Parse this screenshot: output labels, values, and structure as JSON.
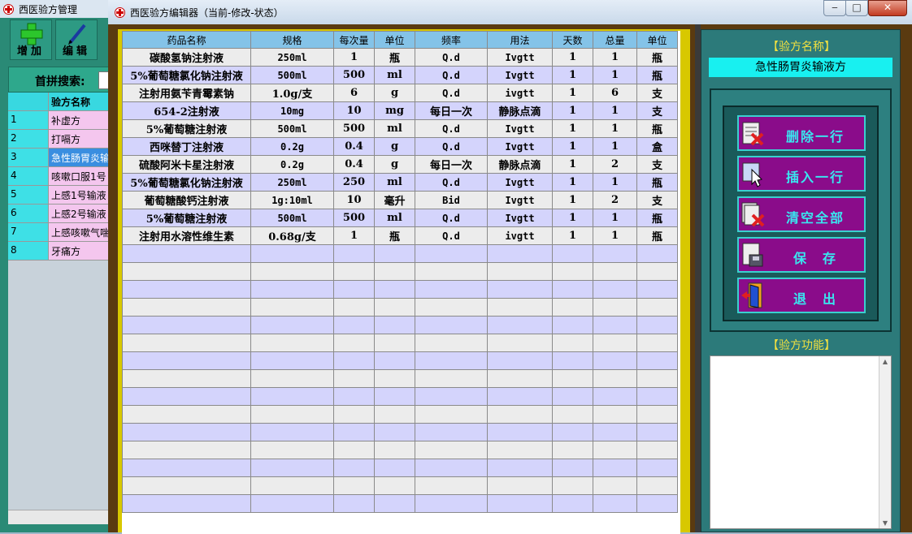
{
  "background_window": {
    "title": "西医验方管理",
    "toolbar": {
      "add_label": "增加",
      "edit_label": "编辑"
    },
    "search_label": "首拼搜索:",
    "grid": {
      "header": {
        "num": "",
        "name": "验方名称"
      },
      "rows": [
        {
          "num": "1",
          "name": "补虚方"
        },
        {
          "num": "2",
          "name": "打嗝方"
        },
        {
          "num": "3",
          "name": "急性肠胃炎输"
        },
        {
          "num": "4",
          "name": "咳嗽口服1号"
        },
        {
          "num": "5",
          "name": "上感1号输液"
        },
        {
          "num": "6",
          "name": "上感2号输液"
        },
        {
          "num": "7",
          "name": "上感咳嗽气喘"
        },
        {
          "num": "8",
          "name": "牙痛方"
        }
      ]
    }
  },
  "main_window": {
    "title": "西医验方编辑器（当前-修改-状态）",
    "controls": {
      "minimize": "‒",
      "maximize": "□",
      "close": "✕"
    },
    "table": {
      "headers": [
        "药品名称",
        "规格",
        "每次量",
        "单位",
        "频率",
        "用法",
        "天数",
        "总量",
        "单位"
      ],
      "rows": [
        [
          "碳酸氢钠注射液",
          "250ml",
          "1",
          "瓶",
          "Q.d",
          "Ivgtt",
          "1",
          "1",
          "瓶"
        ],
        [
          "5%葡萄糖氯化钠注射液",
          "500ml",
          "500",
          "ml",
          "Q.d",
          "Ivgtt",
          "1",
          "1",
          "瓶"
        ],
        [
          "注射用氨苄青霉素钠",
          "1.0g/支",
          "6",
          "g",
          "Q.d",
          "ivgtt",
          "1",
          "6",
          "支"
        ],
        [
          "654-2注射液",
          "10mg",
          "10",
          "mg",
          "每日一次",
          "静脉点滴",
          "1",
          "1",
          "支"
        ],
        [
          "5%葡萄糖注射液",
          "500ml",
          "500",
          "ml",
          "Q.d",
          "Ivgtt",
          "1",
          "1",
          "瓶"
        ],
        [
          "西咪替丁注射液",
          "0.2g",
          "0.4",
          "g",
          "Q.d",
          "Ivgtt",
          "1",
          "1",
          "盒"
        ],
        [
          "硫酸阿米卡星注射液",
          "0.2g",
          "0.4",
          "g",
          "每日一次",
          "静脉点滴",
          "1",
          "2",
          "支"
        ],
        [
          "5%葡萄糖氯化钠注射液",
          "250ml",
          "250",
          "ml",
          "Q.d",
          "Ivgtt",
          "1",
          "1",
          "瓶"
        ],
        [
          "葡萄糖酸钙注射液",
          "1g:10ml",
          "10",
          "毫升",
          "Bid",
          "Ivgtt",
          "1",
          "2",
          "支"
        ],
        [
          "5%葡萄糖注射液",
          "500ml",
          "500",
          "ml",
          "Q.d",
          "Ivgtt",
          "1",
          "1",
          "瓶"
        ],
        [
          "注射用水溶性维生素",
          "0.68g/支",
          "1",
          "瓶",
          "Q.d",
          "ivgtt",
          "1",
          "1",
          "瓶"
        ]
      ],
      "empty_rows": 15
    },
    "right_panel": {
      "name_label": "【验方名称】",
      "name_value": "急性肠胃炎输液方",
      "buttons": {
        "delete_row": "删除一行",
        "insert_row": "插入一行",
        "clear_all": "清空全部",
        "save": "保　存",
        "exit": "退　出"
      },
      "function_label": "【验方功能】",
      "function_value": ""
    }
  },
  "colors": {
    "header_bg": "#84c3e8",
    "row_odd": "#ececec",
    "row_even": "#d4d4fc",
    "button_bg": "#8a0c8a",
    "button_text": "#38e8f0",
    "panel_bg": "#2c7a7a",
    "label_yellow": "#f0e040"
  }
}
